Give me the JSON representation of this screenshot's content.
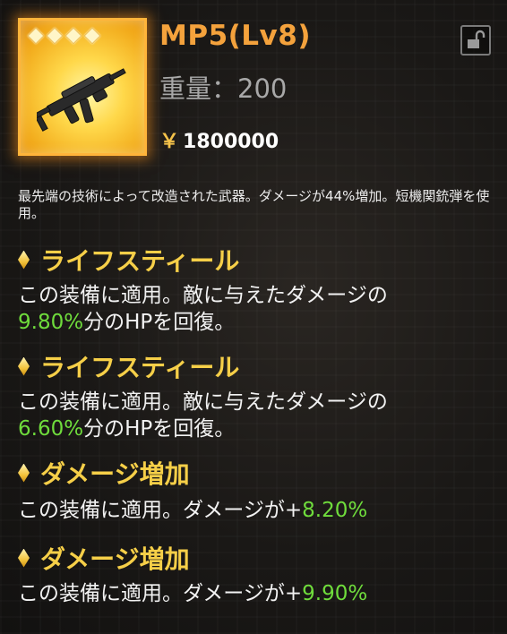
{
  "item": {
    "name": "MP5(Lv8)",
    "weight_label": "重量：200",
    "currency_symbol": "￥",
    "price": "1800000",
    "star_count": 4,
    "description": "最先端の技術によって改造された武器。ダメージが44%増加。短機関銃弾を使用。"
  },
  "skills": [
    {
      "title": "ライフスティール",
      "line1": "この装備に適用。敵に与えたダメージの",
      "value": "9.80%",
      "suffix": "分のHPを回復。"
    },
    {
      "title": "ライフスティール",
      "line1": "この装備に適用。敵に与えたダメージの",
      "value": "6.60%",
      "suffix": "分のHPを回復。"
    },
    {
      "title": "ダメージ増加",
      "prefix": "この装備に適用。ダメージが+",
      "value": "8.20%"
    },
    {
      "title": "ダメージ増加",
      "prefix": "この装備に適用。ダメージが+",
      "value": "9.90%"
    }
  ],
  "icons": {
    "lock": "unlock-icon",
    "gun": "smg-icon",
    "star": "star-icon",
    "bullet": "diamond-icon"
  },
  "colors": {
    "title": "#f4a23c",
    "skill_title": "#f6cf48",
    "value_green": "#6fdc3c",
    "icon_gold": "#ffd84a"
  }
}
